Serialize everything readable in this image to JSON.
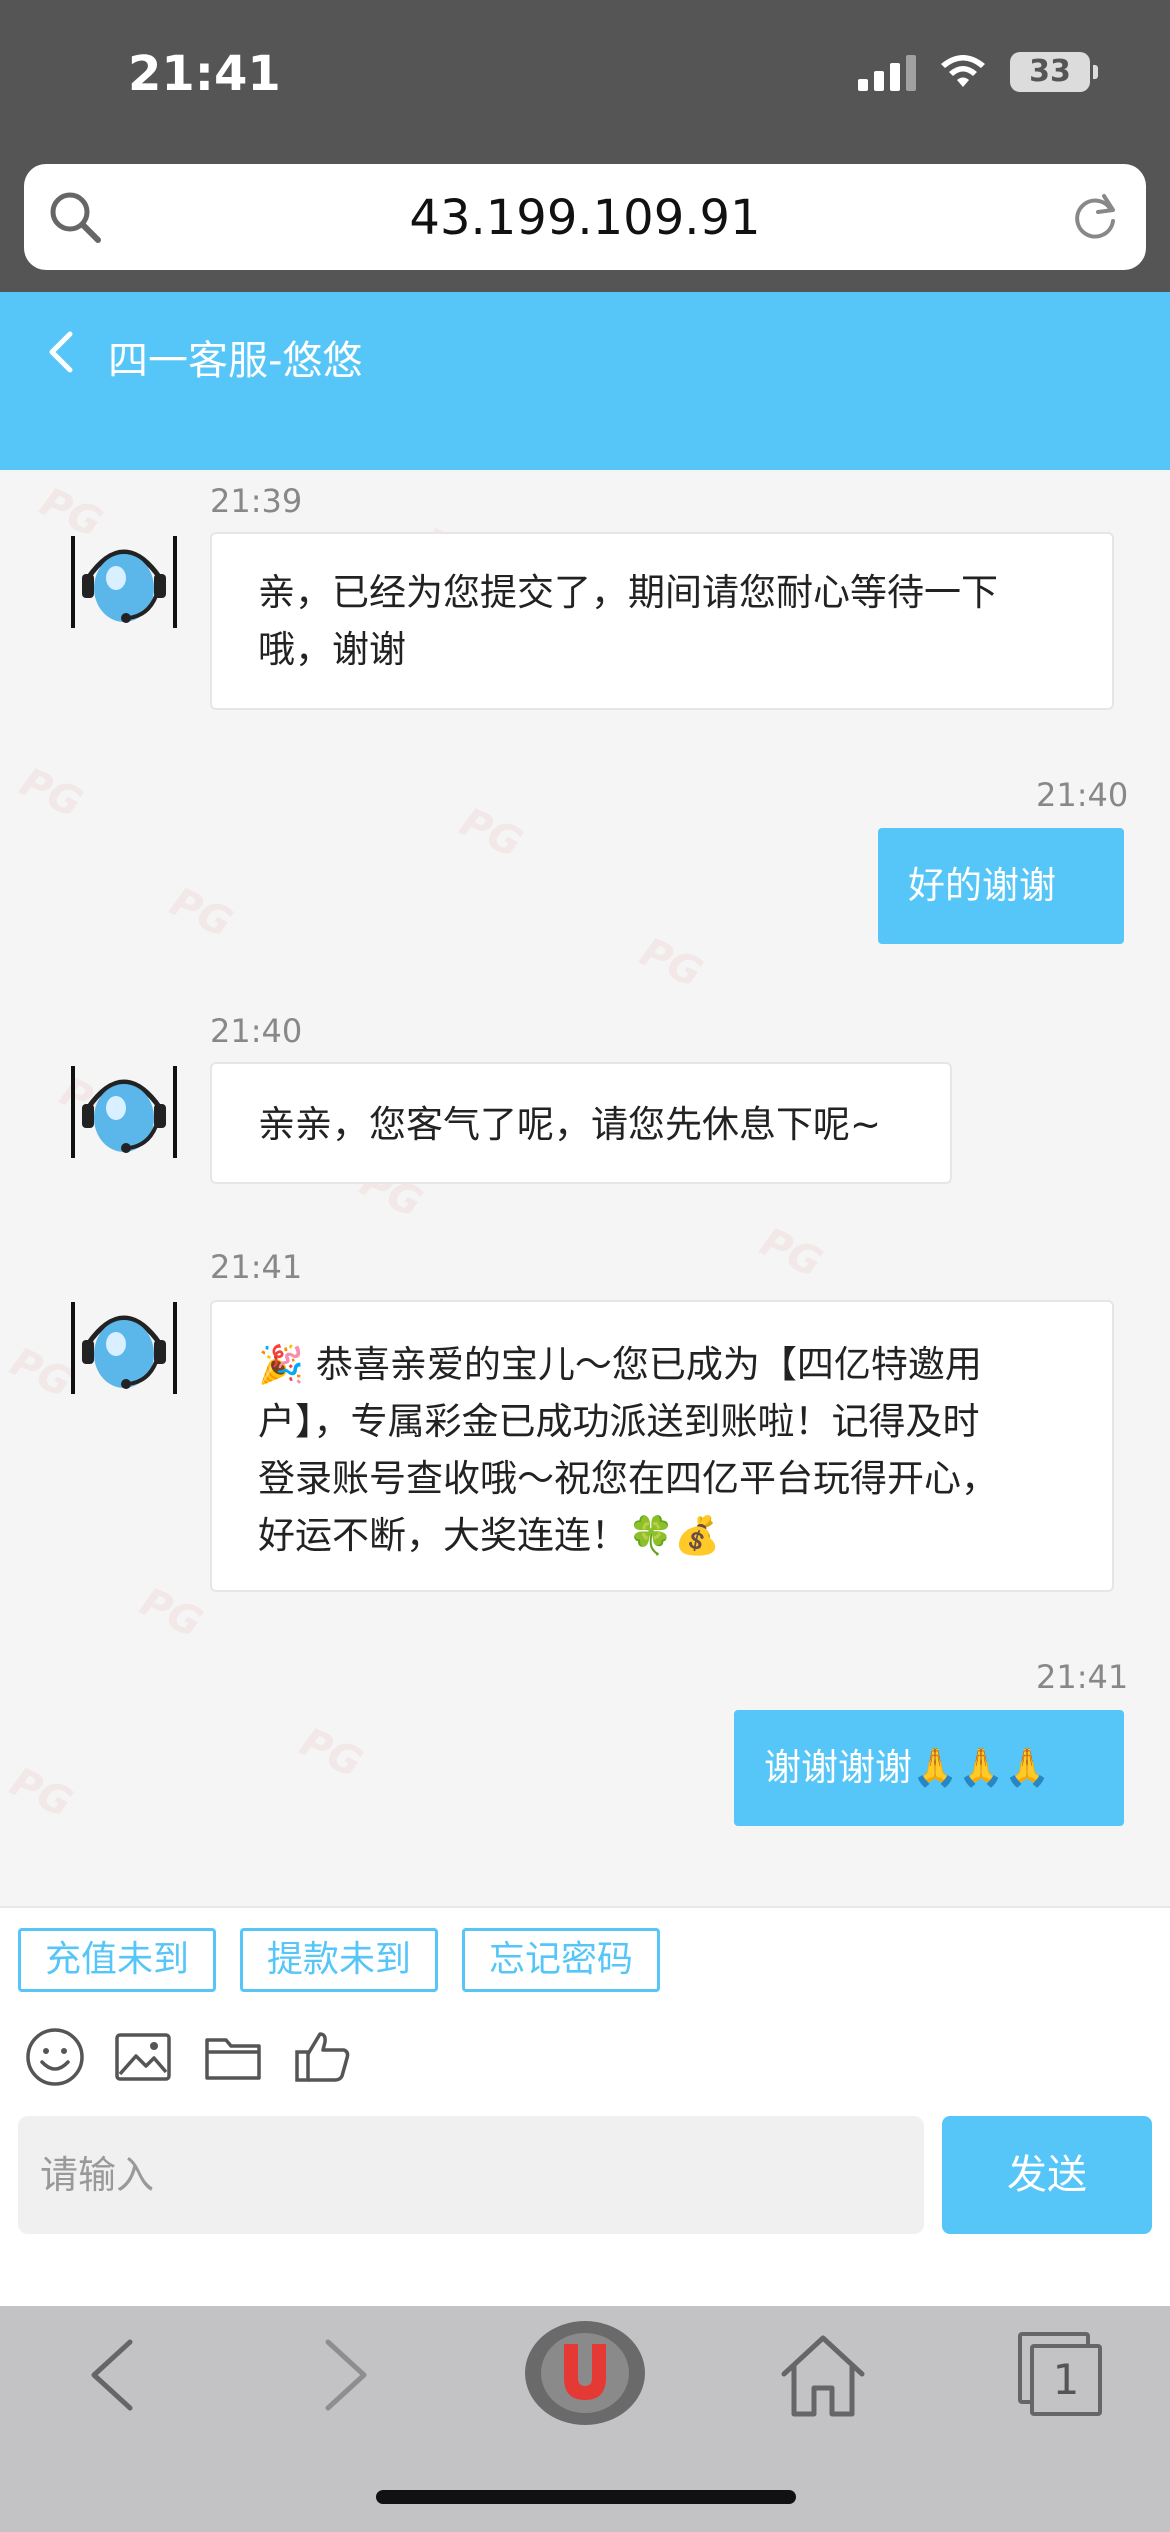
{
  "status_bar": {
    "time": "21:41",
    "battery": "33"
  },
  "url_bar": {
    "url": "43.199.109.91"
  },
  "chat": {
    "title": "四一客服-悠悠"
  },
  "messages": [
    {
      "side": "in",
      "time": "21:39",
      "line1": "亲，已经为您提交了，期间请您耐心等待一下",
      "line2": "哦，谢谢"
    },
    {
      "side": "out",
      "time": "21:40",
      "text": "好的谢谢"
    },
    {
      "side": "in",
      "time": "21:40",
      "line1": "亲亲，您客气了呢，请您先休息下呢~"
    },
    {
      "side": "in",
      "time": "21:41",
      "line1": "🎉 恭喜亲爱的宝儿～您已成为【四亿特邀用",
      "line2": "户】，专属彩金已成功派送到账啦！记得及时",
      "line3": "登录账号查收哦～祝您在四亿平台玩得开心，",
      "line4": "好运不断，大奖连连！🍀💰"
    },
    {
      "side": "out",
      "time": "21:41",
      "text": "谢谢谢谢🙏🙏🙏"
    }
  ],
  "quick_replies": [
    "充值未到",
    "提款未到",
    "忘记密码"
  ],
  "composer": {
    "placeholder": "请输入",
    "send_label": "发送"
  },
  "browser_bar": {
    "tabs_count": "1"
  },
  "watermark_text": "PG",
  "colors": {
    "accent": "#55c6f7",
    "chrome": "#555555",
    "toolbar": "#c3c3c5"
  }
}
